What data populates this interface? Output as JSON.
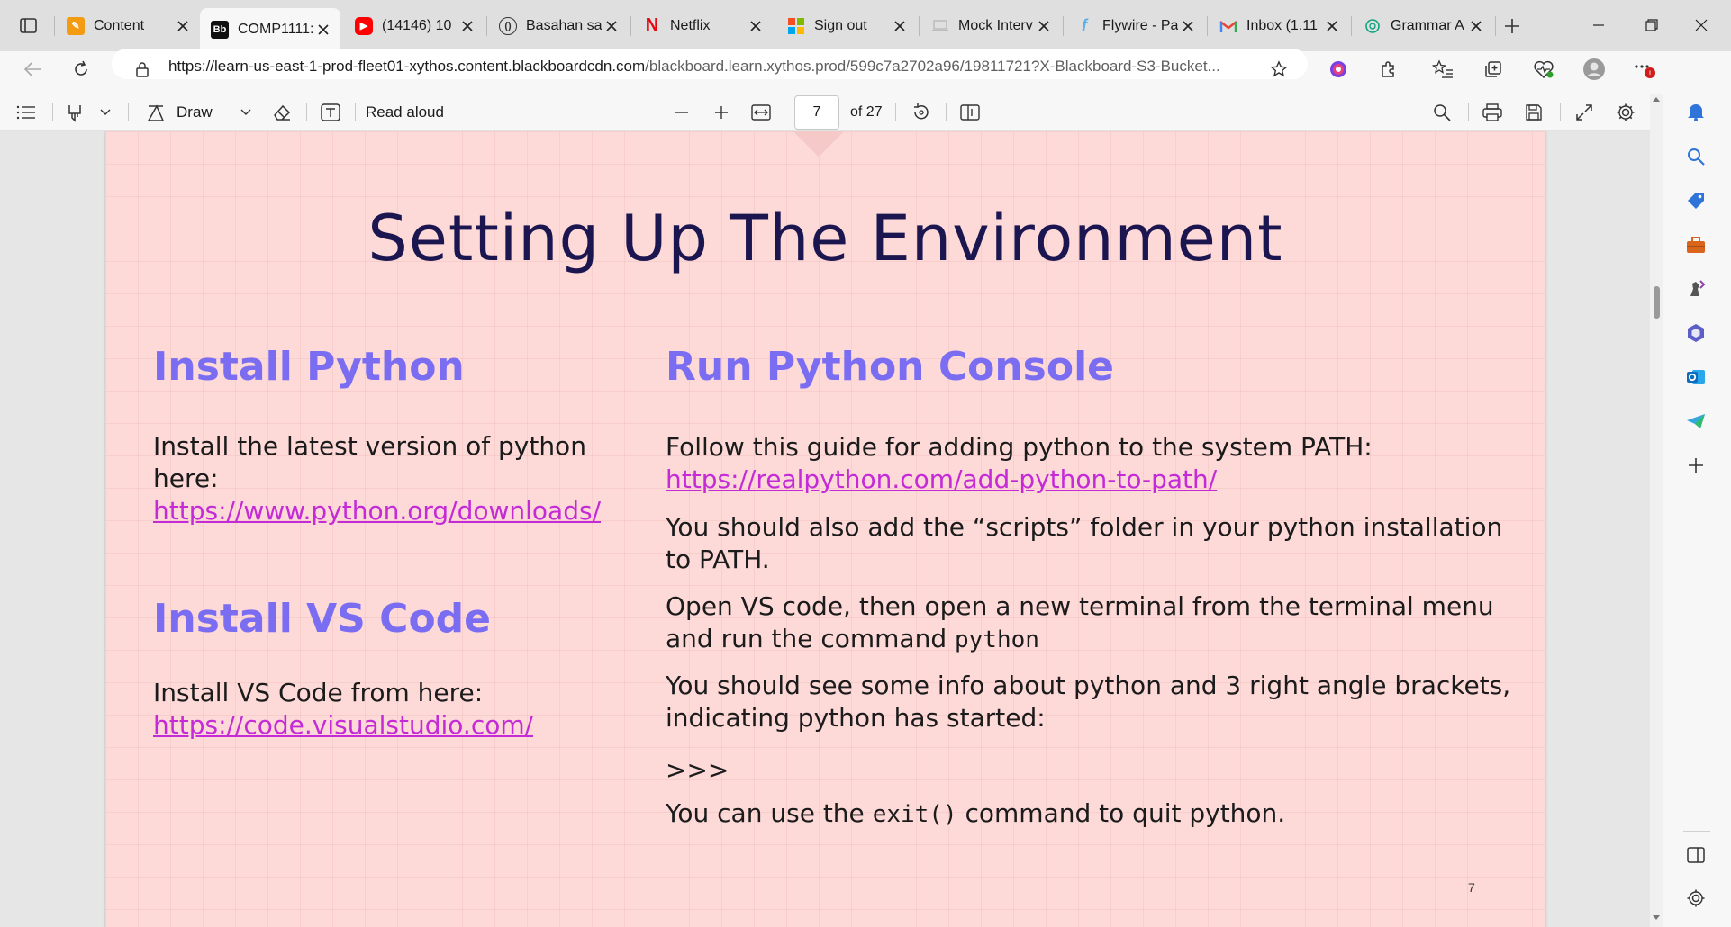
{
  "tabs": [
    {
      "title": "Content",
      "favicon": "pencil-favicon",
      "color": "#f39c12"
    },
    {
      "title": "COMP1111:",
      "favicon": "blackboard-favicon",
      "color": "#111111",
      "active": true
    },
    {
      "title": "(14146) 10",
      "favicon": "youtube-favicon",
      "color": "#ff0000"
    },
    {
      "title": "Basahan sa",
      "favicon": "globe-favicon",
      "color": "#333333"
    },
    {
      "title": "Netflix",
      "favicon": "netflix-favicon",
      "color": "#e50914"
    },
    {
      "title": "Sign out",
      "favicon": "microsoft-favicon",
      "color": "#7fba00"
    },
    {
      "title": "Mock Interv",
      "favicon": "laptop-favicon",
      "color": "#bbbbbb"
    },
    {
      "title": "Flywire - Pa",
      "favicon": "flywire-favicon",
      "color": "#5ab0e8"
    },
    {
      "title": "Inbox (1,11",
      "favicon": "gmail-favicon",
      "color": "#ea4335"
    },
    {
      "title": "Grammar A",
      "favicon": "chatgpt-favicon",
      "color": "#10a37f"
    }
  ],
  "address": {
    "url_host": "https://learn-us-east-1-prod-fleet01-xythos.content.blackboardcdn.com",
    "url_path": "/blackboard.learn.xythos.prod/599c7a2702a96/19811721?X-Blackboard-S3-Bucket..."
  },
  "pdf_toolbar": {
    "draw_label": "Draw",
    "read_aloud_label": "Read aloud",
    "page_value": "7",
    "page_total": "of 27"
  },
  "slide": {
    "title": "Setting Up The Environment",
    "install_python": {
      "heading": "Install Python",
      "text": "Install the latest version of python here:",
      "link": "https://www.python.org/downloads/"
    },
    "install_vscode": {
      "heading": "Install VS Code",
      "text": "Install VS Code from here:",
      "link": "https://code.visualstudio.com/"
    },
    "run_console": {
      "heading": "Run Python Console",
      "p1_text": "Follow this guide for adding python to the system PATH:",
      "p1_link": "https://realpython.com/add-python-to-path/",
      "p2_line1": "You should also add the “scripts” folder in your python installation",
      "p2_line2": "to PATH.",
      "p3_line1": "Open VS code, then open a new terminal from the terminal menu",
      "p3_line2_text": "and run the command ",
      "p3_code": "python",
      "p4_line1": "You should see some info about python and 3 right angle brackets,",
      "p4_line2": "indicating python has started:",
      "prompt": ">>>",
      "p5_before": "You can use the ",
      "p5_code": "exit()",
      "p5_after": " command to quit python."
    },
    "page_number": "7"
  },
  "colors": {
    "slide_bg": "#fdd9d8",
    "title": "#1c1650",
    "heading": "#7a6df1",
    "link": "#c52ad7"
  }
}
